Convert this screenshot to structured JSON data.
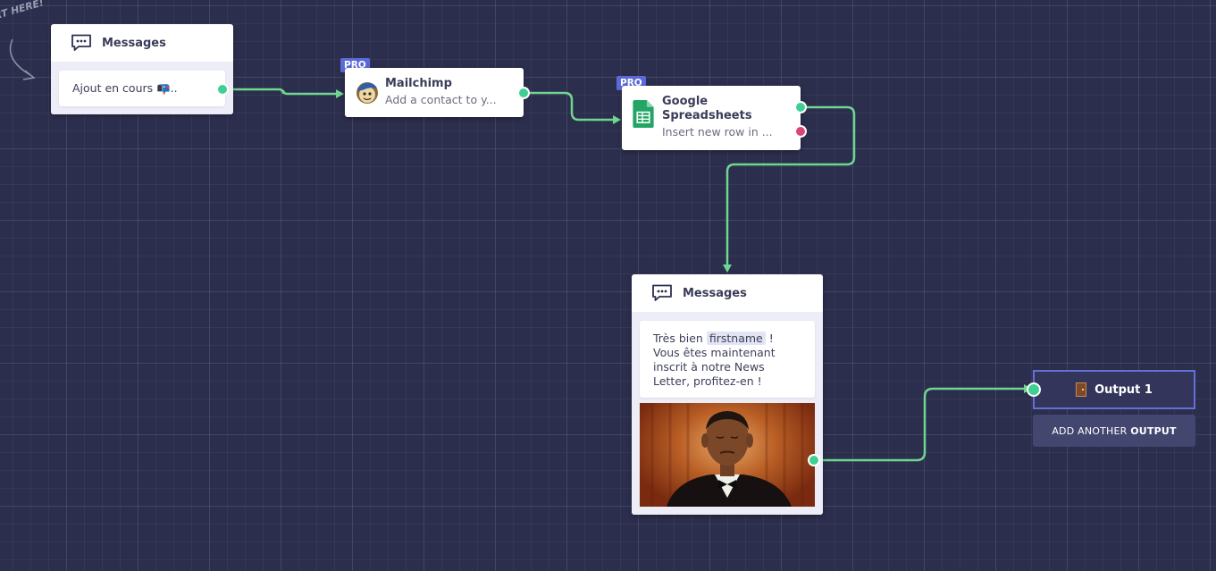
{
  "canvas": {
    "start_hint": "RT HERE!"
  },
  "nodes": {
    "messages_start": {
      "title": "Messages",
      "message": "Ajout en cours 📭.."
    },
    "mailchimp": {
      "badge": "PRO",
      "title": "Mailchimp",
      "subtitle": "Add a contact to y..."
    },
    "google_sheets": {
      "badge": "PRO",
      "title_line1": "Google",
      "title_line2": "Spreadsheets",
      "subtitle": "Insert new row in ..."
    },
    "messages_end": {
      "title": "Messages",
      "text_before": "Très bien ",
      "variable": "firstname",
      "text_after": " ! Vous êtes maintenant inscrit à notre News Letter, profitez-en !",
      "image_alt": "GIF image"
    }
  },
  "output": {
    "icon": "door-icon",
    "label": "Output 1",
    "add_label_prefix": "ADD ANOTHER ",
    "add_label_bold": "OUTPUT"
  },
  "colors": {
    "background": "#2c2e4d",
    "connection": "#6fd68f",
    "port_success": "#3fcf95",
    "port_error": "#d9447a",
    "pro_badge": "#5b6ad8",
    "output_border": "#6470d6"
  }
}
